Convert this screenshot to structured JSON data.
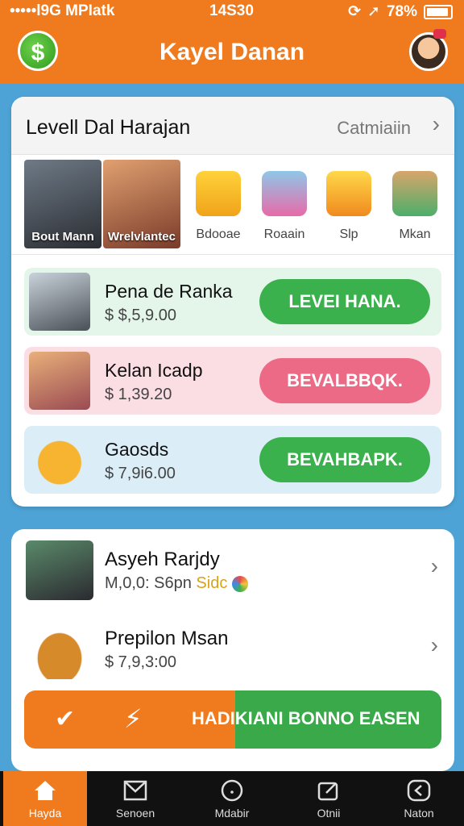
{
  "status_bar": {
    "carrier": "•••••l9G MPIatk",
    "time": "14S30",
    "battery": "78%"
  },
  "header": {
    "title": "Kayel Danan"
  },
  "card": {
    "title": "Levell Dal Harajan",
    "link": "Catmiaiin",
    "categories": [
      {
        "label": "Bout Mann"
      },
      {
        "label": "Wrelvlantec"
      },
      {
        "label": "Bdooae"
      },
      {
        "label": "Roaain"
      },
      {
        "label": "Slp"
      },
      {
        "label": "Mkan"
      }
    ],
    "rows": [
      {
        "name": "Pena de Ranka",
        "price": "$ $,5,9.00",
        "button": "LEVEI HANA."
      },
      {
        "name": "Kelan Icadp",
        "price": "$ 1,39.20",
        "button": "BEVALBBQK."
      },
      {
        "name": "Gaosds",
        "price": "$ 7,9i6.00",
        "button": "BEVAHBAPK."
      }
    ]
  },
  "list": [
    {
      "name": "Asyeh Rarjdy",
      "sub": "M,0,0: S6pn",
      "sub_tag": "Sidc"
    },
    {
      "name": "Prepilon Msan",
      "sub": "$ 7,9,3:00"
    }
  ],
  "cta": {
    "label": "HADIKIANI BONNO EASEN"
  },
  "nav": [
    {
      "label": "Hayda"
    },
    {
      "label": "Senoen"
    },
    {
      "label": "Mdabir"
    },
    {
      "label": "Otnii"
    },
    {
      "label": "Naton"
    }
  ]
}
